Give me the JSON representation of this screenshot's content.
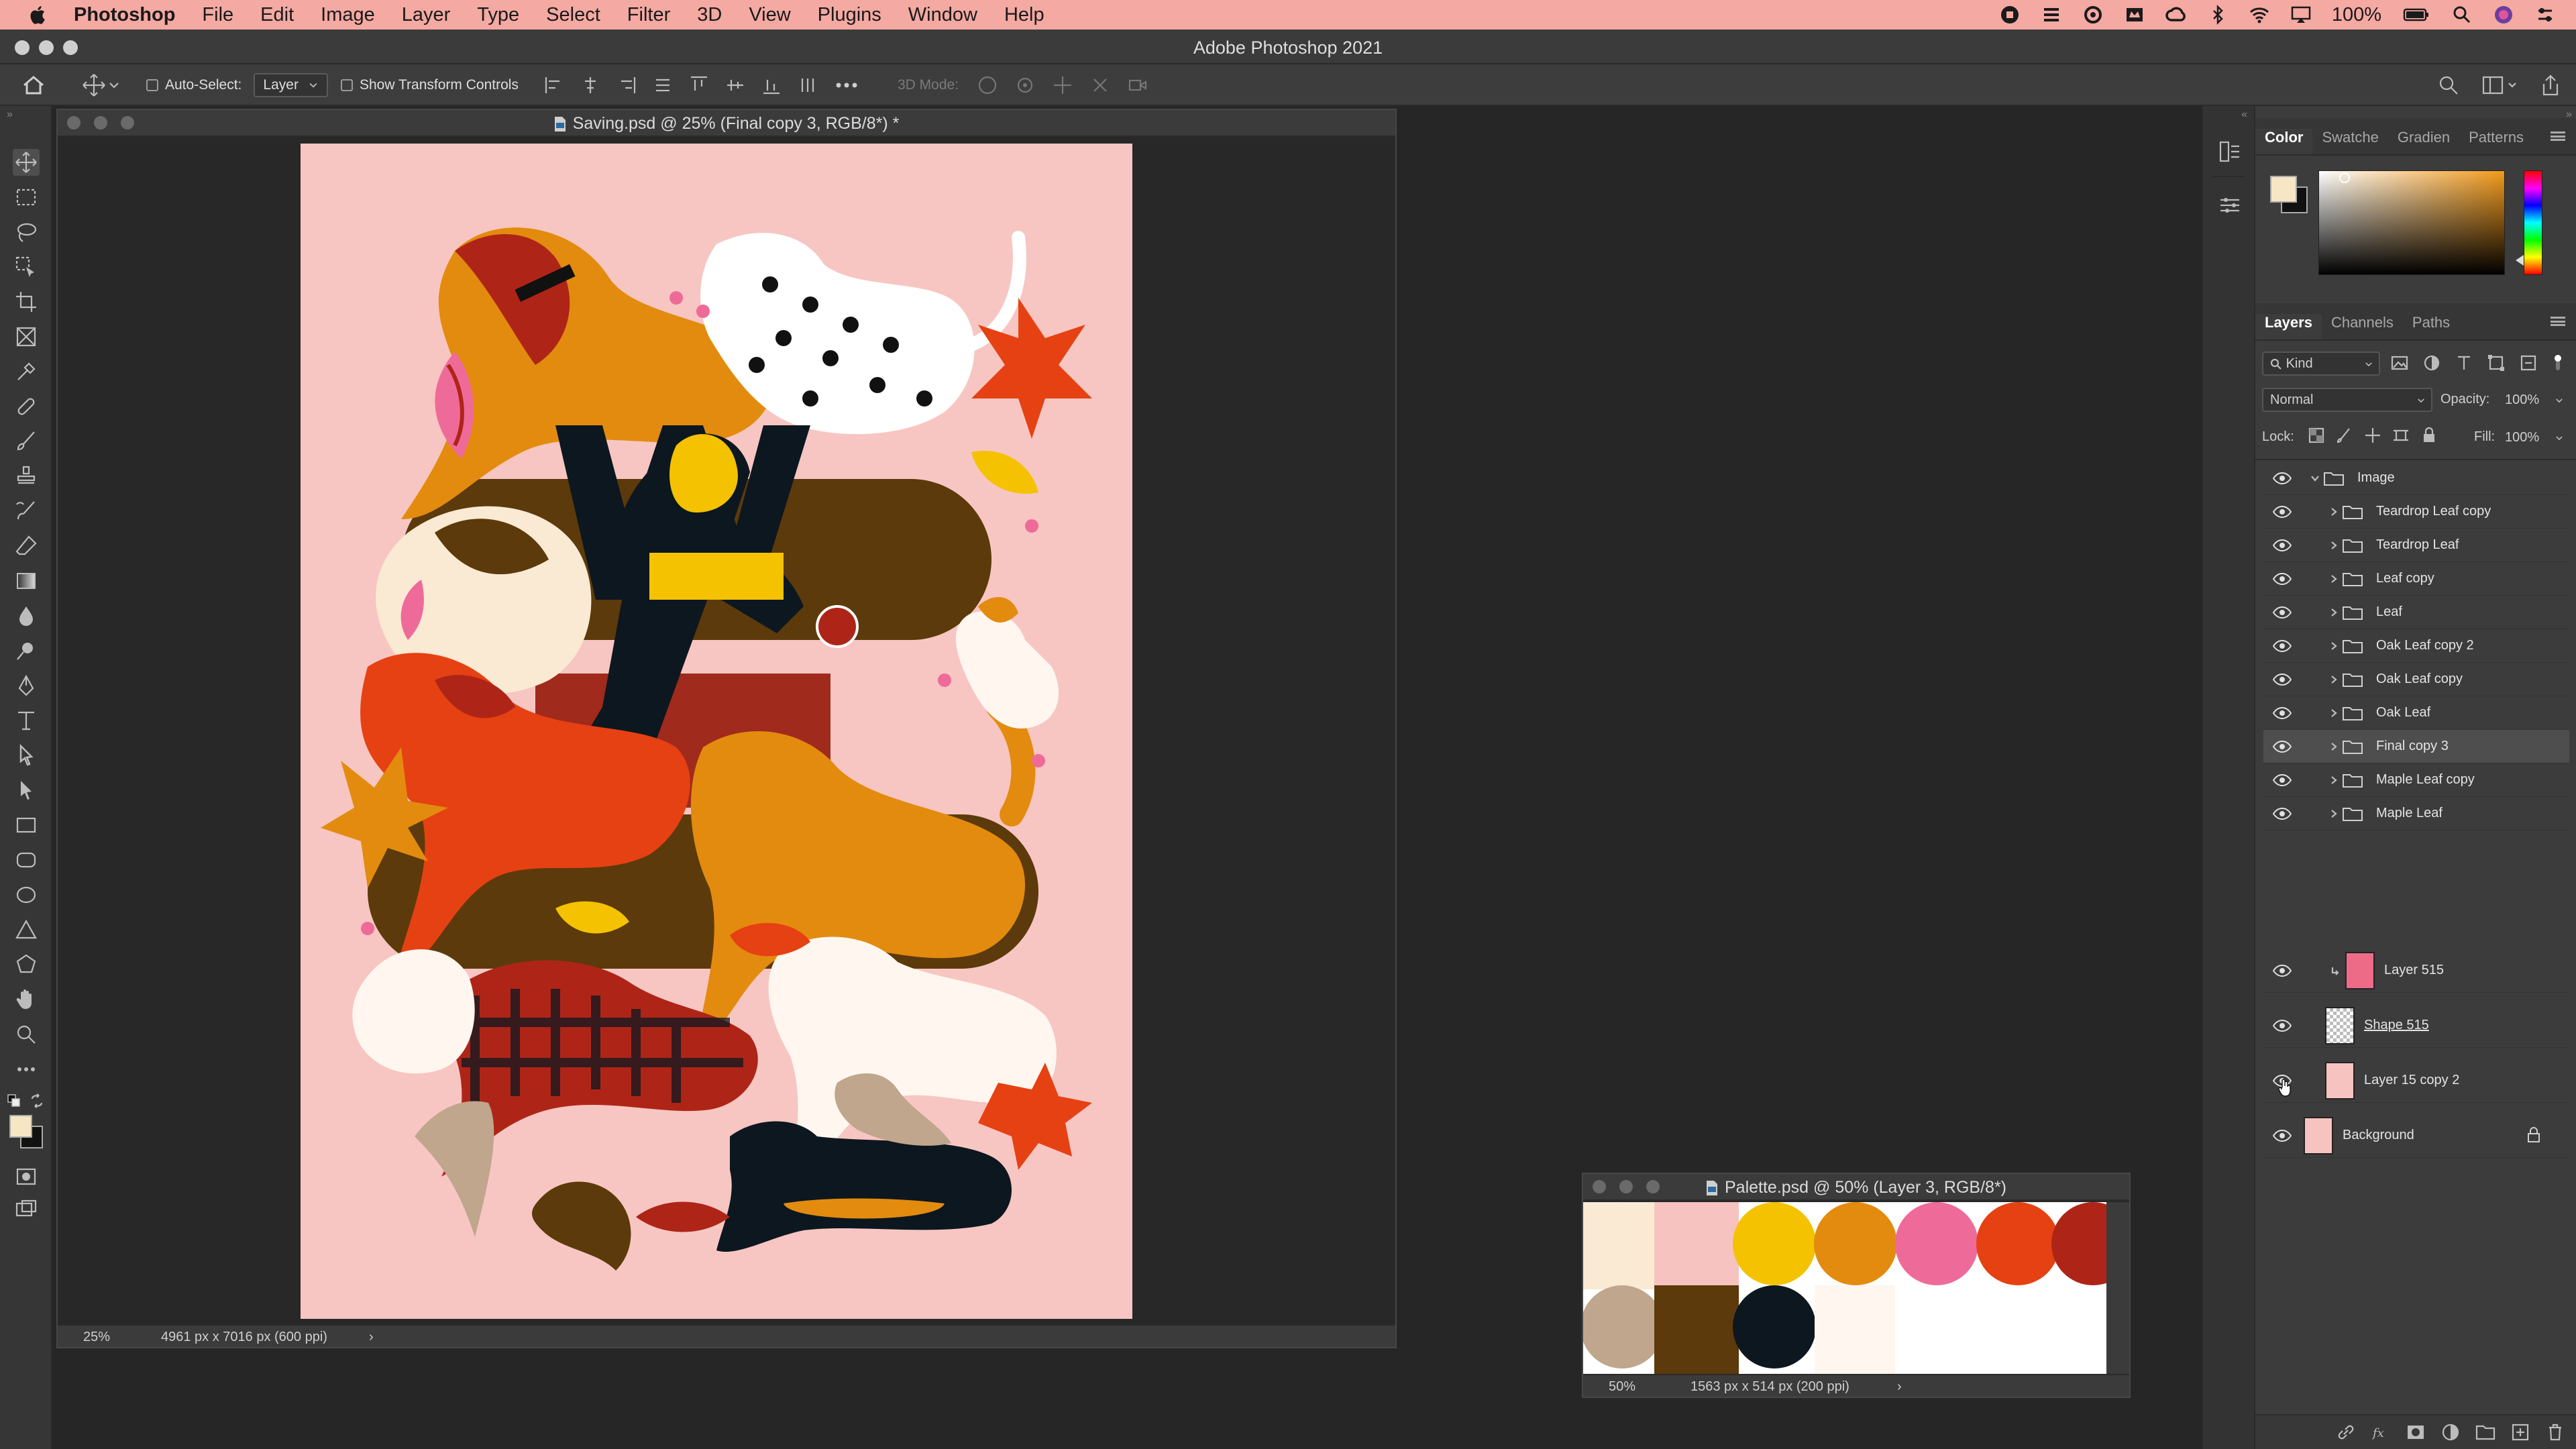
{
  "menubar": {
    "app": "Photoshop",
    "items": [
      "File",
      "Edit",
      "Image",
      "Layer",
      "Type",
      "Select",
      "Filter",
      "3D",
      "View",
      "Plugins",
      "Window",
      "Help"
    ],
    "battery": "100%"
  },
  "window": {
    "title": "Adobe Photoshop 2021"
  },
  "options": {
    "auto_select_label": "Auto-Select:",
    "auto_select_value": "Layer",
    "transform_label": "Show Transform Controls",
    "mode_3d_label": "3D Mode:"
  },
  "doc_main": {
    "title": "Saving.psd @ 25% (Final copy 3, RGB/8*) *",
    "zoom": "25%",
    "dims": "4961 px x 7016 px (600 ppi)",
    "canvas_color": "#f7c6c2"
  },
  "doc_palette": {
    "title": "Palette.psd @ 50% (Layer 3, RGB/8*)",
    "zoom": "50%",
    "dims": "1563 px x 514 px (200 ppi)",
    "swatches_row1": [
      "#fae9d3",
      "#f7c3c0",
      "#f4c200",
      "#e38b0e",
      "#ee6b99",
      "#e64112",
      "#ae2518"
    ],
    "swatches_row2": [
      "#bfa68c",
      "#5c3a0b",
      "#0d1720",
      "#fff7ef"
    ]
  },
  "color_panel": {
    "tabs": [
      "Color",
      "Swatche",
      "Gradien",
      "Patterns"
    ],
    "fg_color": "#f7e6c4",
    "bg_color": "#111111",
    "picker_hue": "#f29a1c"
  },
  "layers_panel": {
    "tabs": [
      "Layers",
      "Channels",
      "Paths"
    ],
    "filter_kind": "Kind",
    "blend_mode": "Normal",
    "opacity_label": "Opacity:",
    "opacity_value": "100%",
    "lock_label": "Lock:",
    "fill_label": "Fill:",
    "fill_value": "100%",
    "group_name": "Image",
    "groups": [
      "Teardrop Leaf copy",
      "Teardrop Leaf",
      "Leaf copy",
      "Leaf",
      "Oak Leaf copy 2",
      "Oak Leaf copy",
      "Oak Leaf",
      "Final copy 3",
      "Maple Leaf copy",
      "Maple Leaf"
    ],
    "selected_group": "Final copy 3",
    "layers": [
      {
        "name": "Layer 515",
        "thumb": "#ee6b88"
      },
      {
        "name": "Shape 515",
        "thumb": "#e8e8e8"
      },
      {
        "name": "Layer 15 copy 2",
        "thumb": "#f7c3c0"
      },
      {
        "name": "Background",
        "thumb": "#f7c3c0"
      }
    ]
  },
  "brand_color": "#e02020"
}
